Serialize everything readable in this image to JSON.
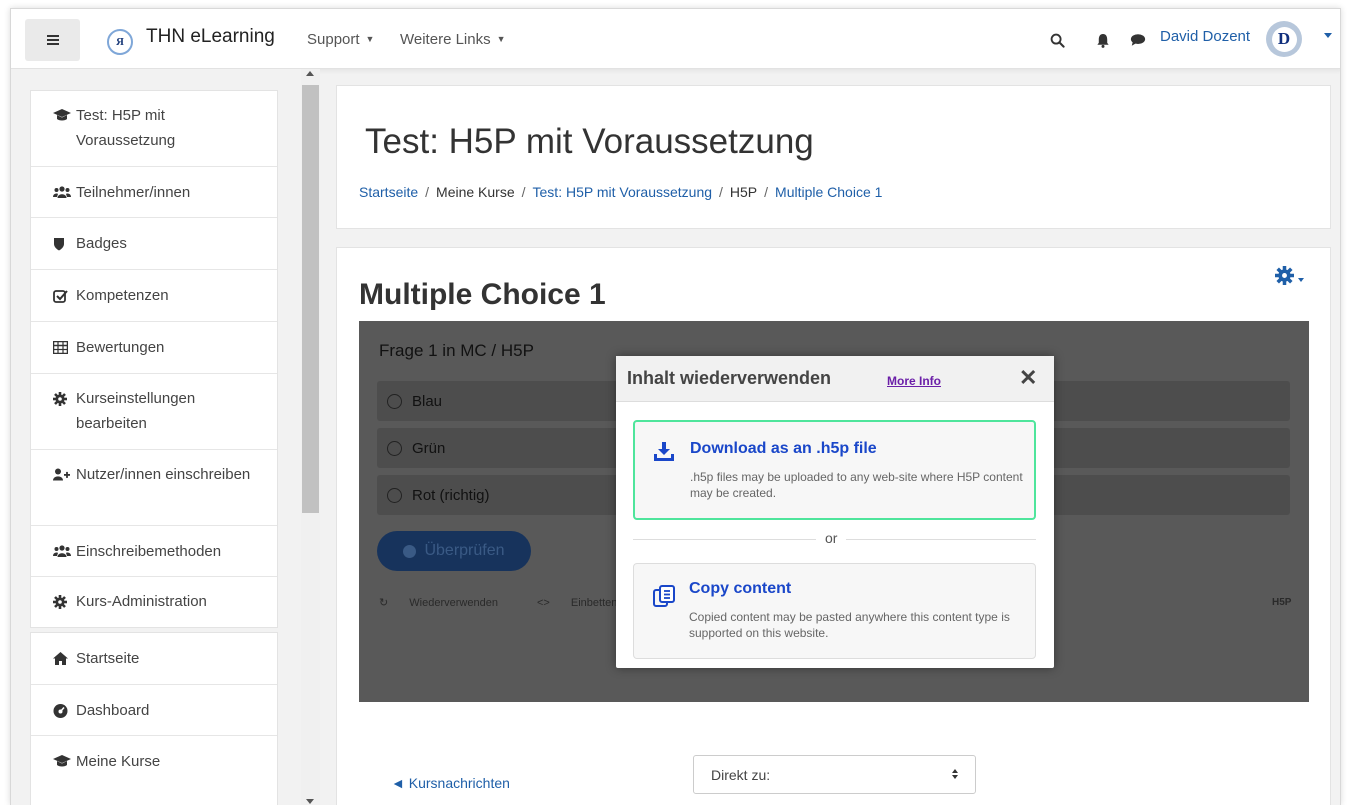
{
  "navbar": {
    "brand": "THN eLearning",
    "logo_text": "Я",
    "links": [
      {
        "label": "Support"
      },
      {
        "label": "Weitere Links"
      }
    ],
    "user_name": "David Dozent",
    "avatar_initial": "D"
  },
  "sidebar": {
    "course_items": [
      {
        "label": "Test: H5P mit Voraussetzung",
        "icon": "graduation-cap-icon"
      },
      {
        "label": "Teilnehmer/innen",
        "icon": "users-icon"
      },
      {
        "label": "Badges",
        "icon": "shield-icon"
      },
      {
        "label": "Kompetenzen",
        "icon": "checkbox-icon"
      },
      {
        "label": "Bewertungen",
        "icon": "table-icon"
      },
      {
        "label": "Kurseinstellungen bearbeiten",
        "icon": "cog-icon"
      },
      {
        "label": "Nutzer/innen einschreiben",
        "icon": "user-plus-icon"
      },
      {
        "label": "Einschreibemethoden",
        "icon": "users-icon"
      },
      {
        "label": "Kurs-Administration",
        "icon": "cog-icon"
      }
    ],
    "site_items": [
      {
        "label": "Startseite",
        "icon": "home-icon"
      },
      {
        "label": "Dashboard",
        "icon": "dashboard-icon"
      },
      {
        "label": "Meine Kurse",
        "icon": "graduation-cap-icon"
      }
    ]
  },
  "header": {
    "title": "Test: H5P mit Voraussetzung",
    "breadcrumb": [
      {
        "label": "Startseite",
        "link": true
      },
      {
        "label": "Meine Kurse",
        "link": false
      },
      {
        "label": "Test: H5P mit Voraussetzung",
        "link": true
      },
      {
        "label": "H5P",
        "link": false
      },
      {
        "label": "Multiple Choice 1",
        "link": true
      }
    ]
  },
  "activity": {
    "title": "Multiple Choice 1",
    "question": "Frage 1 in MC / H5P",
    "answers": [
      "Blau",
      "Grün",
      "Rot (richtig)"
    ],
    "check_label": "Überprüfen",
    "reuse_label": "Wiederverwenden",
    "embed_label": "Einbetten",
    "h5p_label": "H5P"
  },
  "modal": {
    "title": "Inhalt wiederverwenden",
    "more_info": "More Info",
    "download_title": "Download as an .h5p file",
    "download_desc": ".h5p files may be uploaded to any web-site where H5P content may be created.",
    "or_label": "or",
    "copy_title": "Copy content",
    "copy_desc": "Copied content may be pasted anywhere this content type is supported on this website."
  },
  "footer_nav": {
    "prev_label": "◄ Kursnachrichten",
    "jump_label": "Direkt zu:"
  },
  "colors": {
    "link": "#1f5fa8",
    "modal_highlight": "#4fe59c",
    "modal_title_link": "#1a47c9"
  }
}
